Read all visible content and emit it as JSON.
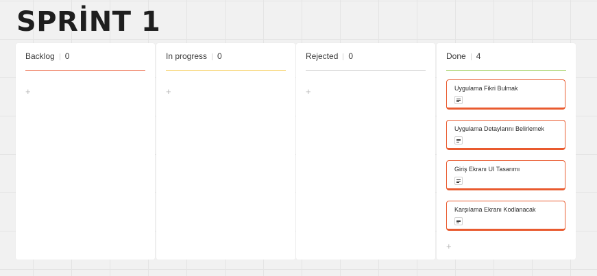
{
  "board": {
    "title": "SPRİNT 1",
    "columns": [
      {
        "name": "Backlog",
        "count": "0",
        "accent": "#e9522a",
        "add_label": "+",
        "cards": []
      },
      {
        "name": "In progress",
        "count": "0",
        "accent": "#f5c542",
        "add_label": "+",
        "cards": []
      },
      {
        "name": "Rejected",
        "count": "0",
        "accent": "#c9c9c9",
        "add_label": "+",
        "cards": []
      },
      {
        "name": "Done",
        "count": "4",
        "accent": "#8fc63f",
        "add_label": "+",
        "cards": [
          {
            "title": "Uygulama Fikri Bulmak",
            "icon": "notes-icon"
          },
          {
            "title": "Uygulama Detaylarını Belirlemek",
            "icon": "notes-icon"
          },
          {
            "title": "Giriş Ekranı UI Tasarımı",
            "icon": "notes-icon"
          },
          {
            "title": "Karşılama Ekranı Kodlanacak",
            "icon": "notes-icon"
          }
        ]
      }
    ],
    "card_accent": "#e95a2e"
  }
}
